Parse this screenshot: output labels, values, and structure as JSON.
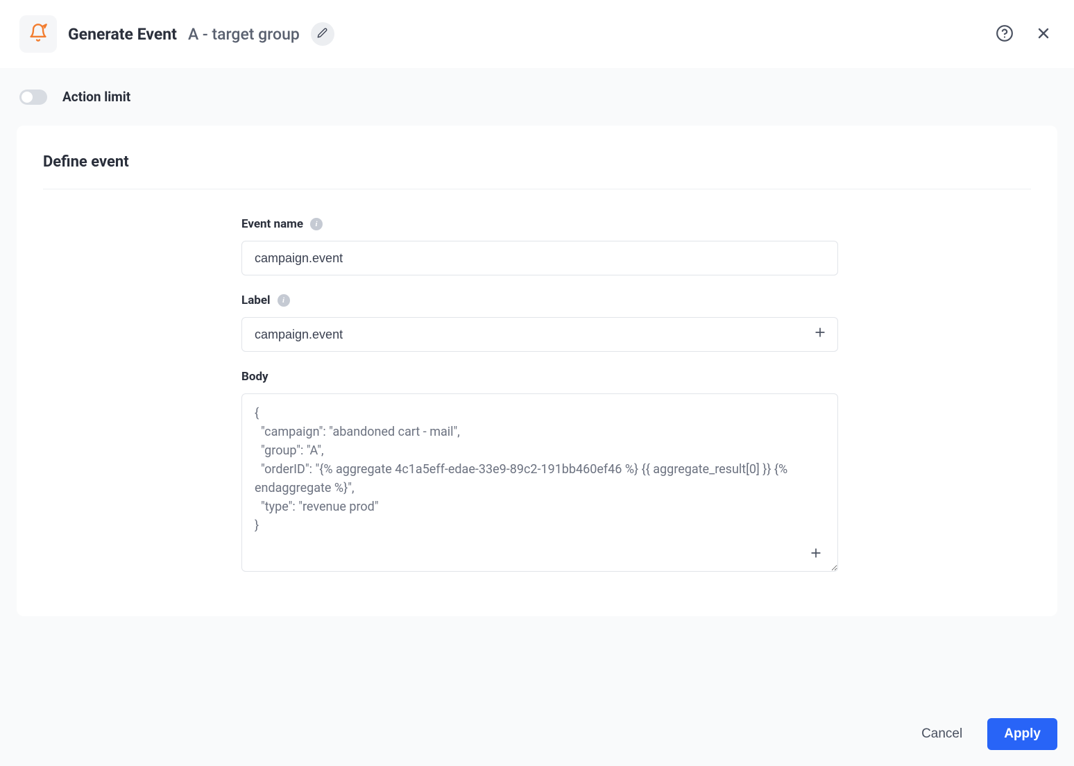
{
  "header": {
    "title": "Generate Event",
    "subtitle": "A - target group"
  },
  "action_limit": {
    "label": "Action limit",
    "enabled": false
  },
  "section": {
    "title": "Define event",
    "fields": {
      "event_name": {
        "label": "Event name",
        "value": "campaign.event"
      },
      "label": {
        "label": "Label",
        "value": "campaign.event"
      },
      "body": {
        "label": "Body",
        "value": "{\n  \"campaign\": \"abandoned cart - mail\",\n  \"group\": \"A\",\n  \"orderID\": \"{% aggregate 4c1a5eff-edae-33e9-89c2-191bb460ef46 %} {{ aggregate_result[0] }} {% endaggregate %}\",\n  \"type\": \"revenue prod\"\n}"
      }
    }
  },
  "footer": {
    "cancel": "Cancel",
    "apply": "Apply"
  }
}
